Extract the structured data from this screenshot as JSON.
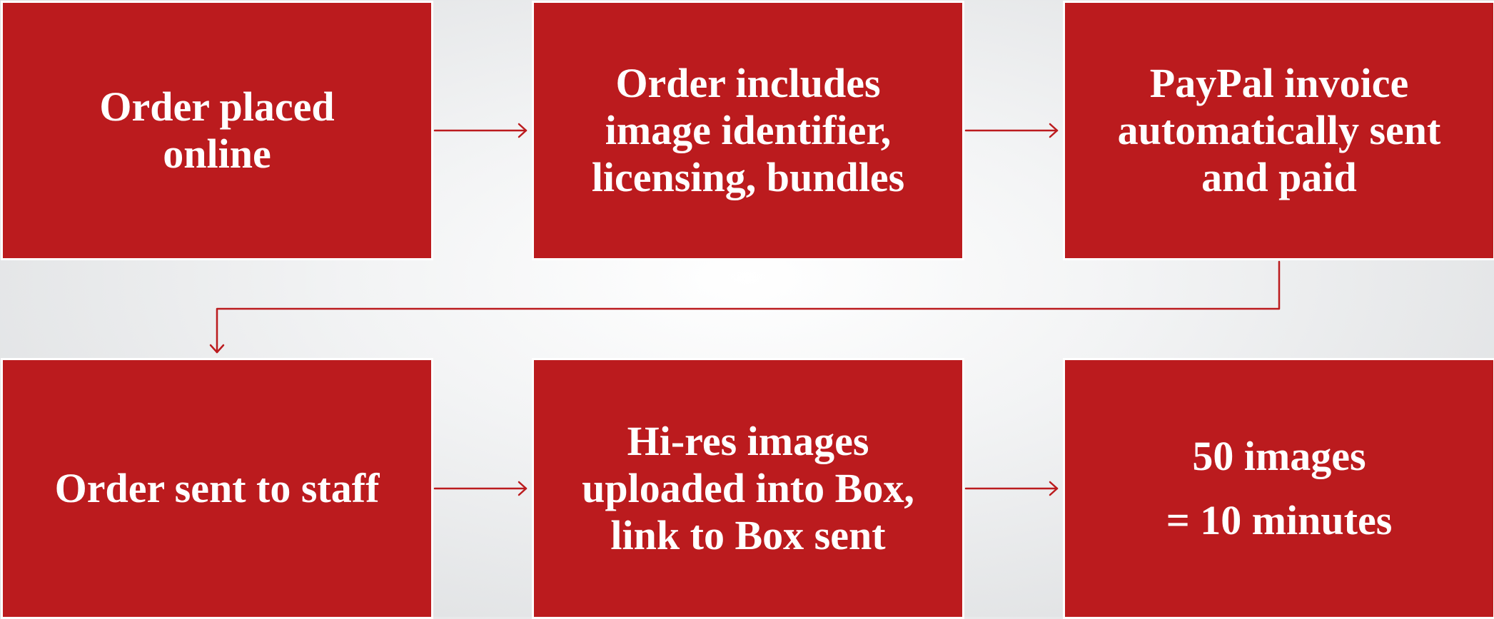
{
  "colors": {
    "box_fill": "#bb1b1e",
    "box_text": "#ffffff",
    "connector": "#bb1b1e",
    "background": "#e8e9ea"
  },
  "steps": [
    {
      "text": "Order placed\nonline"
    },
    {
      "text": "Order includes\nimage identifier,\nlicensing, bundles"
    },
    {
      "text": "PayPal invoice\nautomatically sent\nand paid"
    },
    {
      "text": "Order sent to staff"
    },
    {
      "text": "Hi-res images\nuploaded into Box,\nlink to Box sent"
    },
    {
      "text": "50 images\n= 10 minutes"
    }
  ],
  "connectors": [
    {
      "from": 1,
      "to": 2
    },
    {
      "from": 2,
      "to": 3
    },
    {
      "from": 3,
      "to": 4
    },
    {
      "from": 4,
      "to": 5
    },
    {
      "from": 5,
      "to": 6
    }
  ]
}
